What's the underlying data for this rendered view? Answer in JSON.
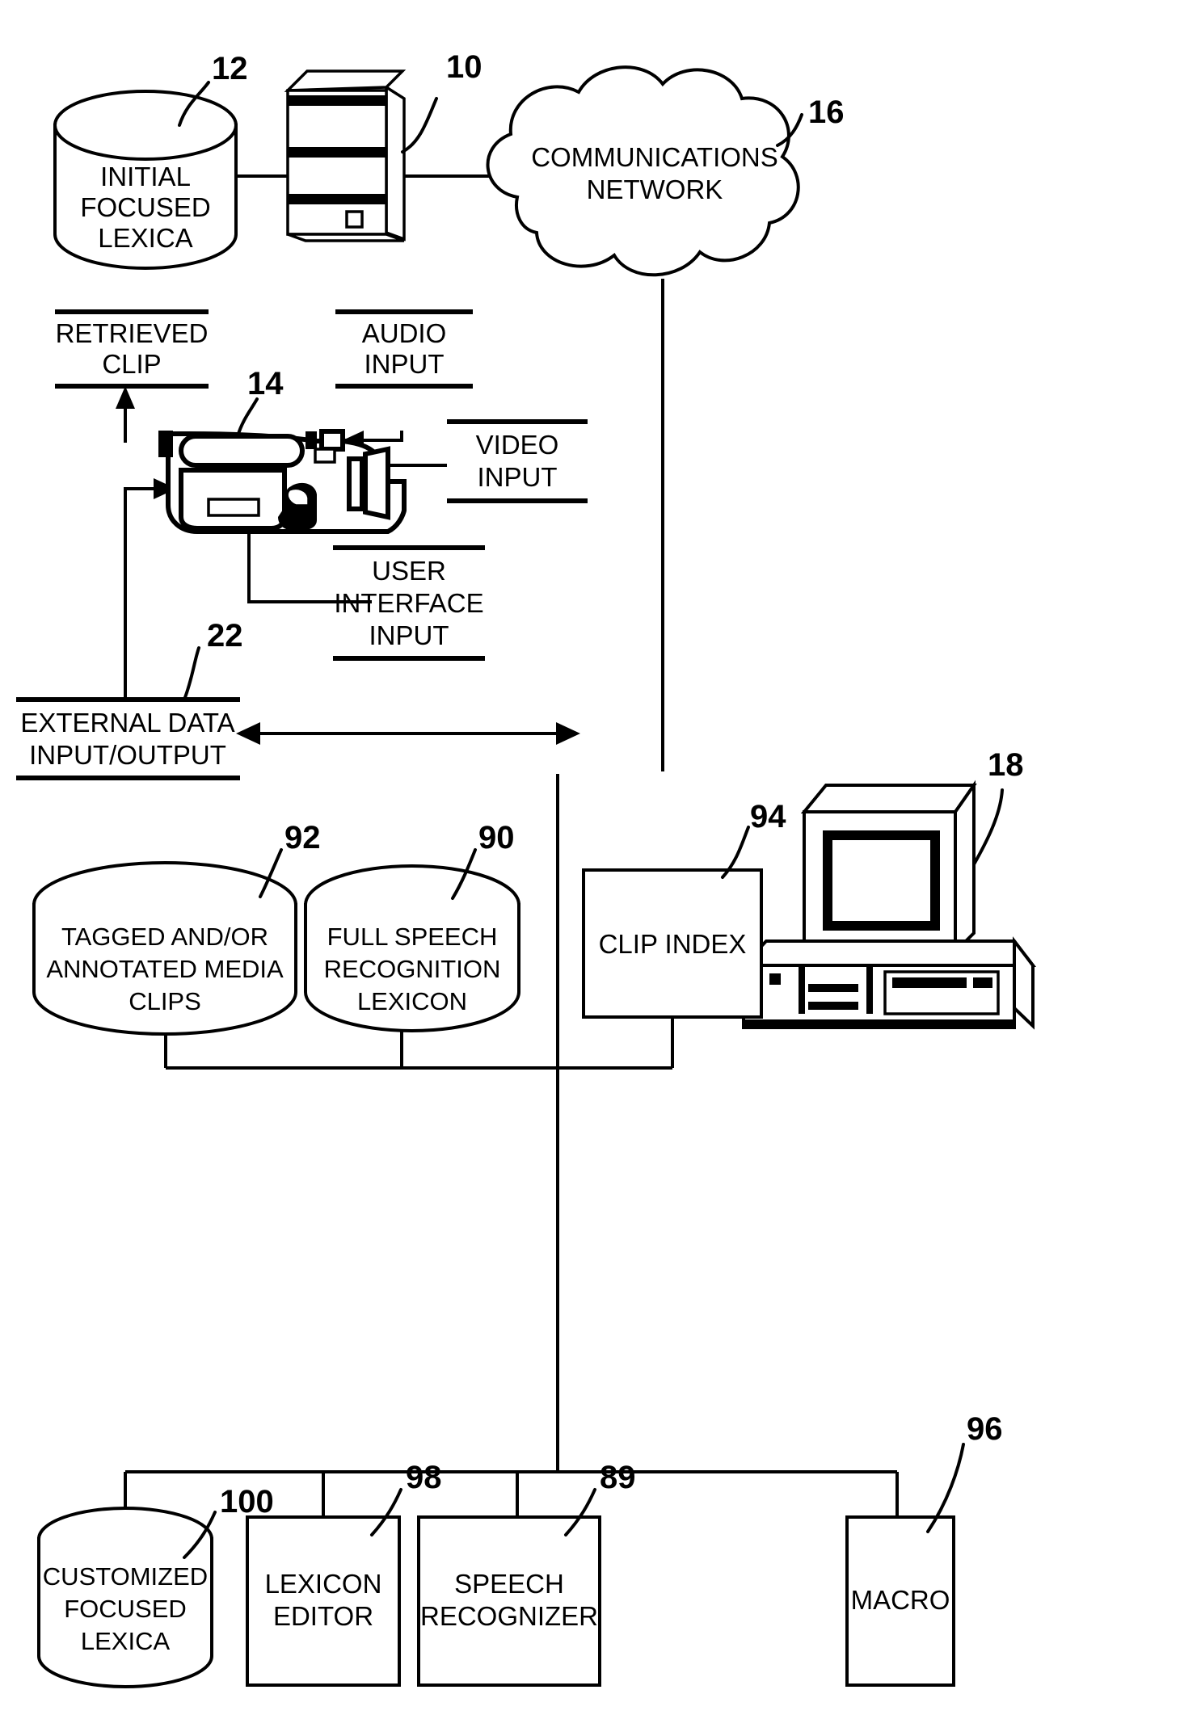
{
  "figure": {
    "title": "Speech recognition media clip system block diagram",
    "line_color": "#000000",
    "background": "#ffffff"
  },
  "nodes": {
    "initial_focused_lexica": {
      "ref": "12",
      "shape": "cylinder",
      "lines": [
        "INITIAL",
        "FOCUSED",
        "LEXICA"
      ]
    },
    "server": {
      "ref": "10",
      "shape": "tower-server",
      "lines": []
    },
    "communications_network": {
      "ref": "16",
      "shape": "cloud",
      "lines": [
        "COMMUNICATIONS",
        "NETWORK"
      ]
    },
    "retrieved_clip": {
      "ref": "",
      "shape": "ruled-label",
      "lines": [
        "RETRIEVED",
        "CLIP"
      ]
    },
    "audio_input": {
      "ref": "",
      "shape": "ruled-label",
      "lines": [
        "AUDIO",
        "INPUT"
      ]
    },
    "video_input": {
      "ref": "",
      "shape": "ruled-label",
      "lines": [
        "VIDEO",
        "INPUT"
      ]
    },
    "user_interface_input": {
      "ref": "",
      "shape": "ruled-label",
      "lines": [
        "USER",
        "INTERFACE",
        "INPUT"
      ]
    },
    "camcorder": {
      "ref": "14",
      "shape": "camcorder",
      "lines": []
    },
    "external_data_io": {
      "ref": "22",
      "shape": "ruled-label",
      "lines": [
        "EXTERNAL DATA",
        "INPUT/OUTPUT"
      ]
    },
    "workstation": {
      "ref": "18",
      "shape": "desktop-computer",
      "lines": []
    },
    "tagged_media_clips": {
      "ref": "92",
      "shape": "cylinder",
      "lines": [
        "TAGGED AND/OR",
        "ANNOTATED MEDIA",
        "CLIPS"
      ]
    },
    "full_speech_recognition_lexicon": {
      "ref": "90",
      "shape": "cylinder",
      "lines": [
        "FULL SPEECH",
        "RECOGNITION",
        "LEXICON"
      ]
    },
    "clip_index": {
      "ref": "94",
      "shape": "box",
      "lines": [
        "CLIP INDEX"
      ]
    },
    "customized_focused_lexica": {
      "ref": "100",
      "shape": "cylinder",
      "lines": [
        "CUSTOMIZED",
        "FOCUSED",
        "LEXICA"
      ]
    },
    "lexicon_editor": {
      "ref": "98",
      "shape": "box",
      "lines": [
        "LEXICON",
        "EDITOR"
      ]
    },
    "speech_recognizer": {
      "ref": "89",
      "shape": "box",
      "lines": [
        "SPEECH",
        "RECOGNIZER"
      ]
    },
    "macro": {
      "ref": "96",
      "shape": "box",
      "lines": [
        "MACRO"
      ]
    }
  },
  "reference_numerals": [
    "10",
    "12",
    "14",
    "16",
    "18",
    "22",
    "89",
    "90",
    "92",
    "94",
    "96",
    "98",
    "100"
  ]
}
